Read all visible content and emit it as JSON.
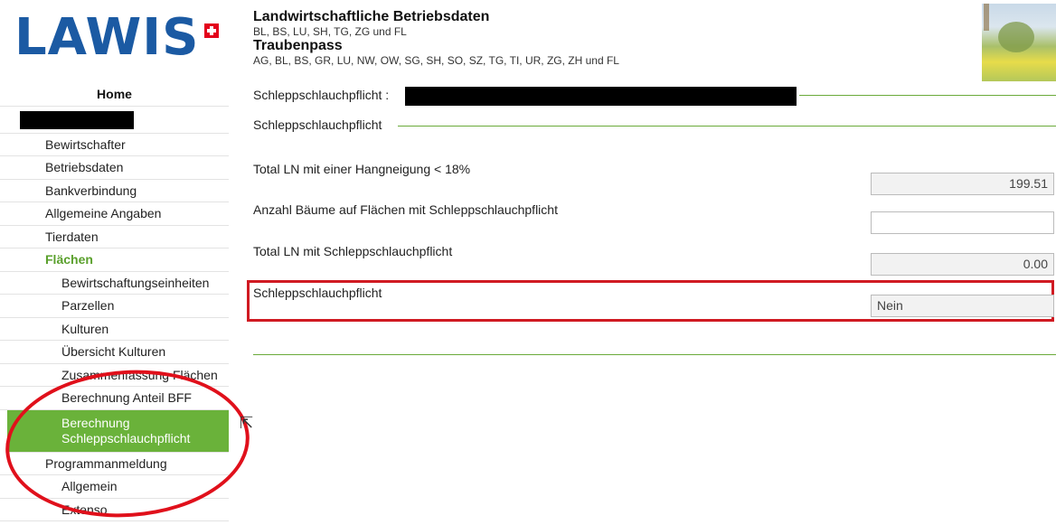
{
  "header": {
    "logo_text": "LAWIS",
    "title1": "Landwirtschaftliche Betriebsdaten",
    "subtitle1": "BL, BS, LU, SH, TG, ZG und FL",
    "title2": "Traubenpass",
    "subtitle2": "AG, BL, BS, GR, LU, NW, OW, SG, SH, SO, SZ, TG, TI, UR, ZG, ZH und FL"
  },
  "sidebar": {
    "home": "Home",
    "items": [
      {
        "label": "Bewirtschafter"
      },
      {
        "label": "Betriebsdaten"
      },
      {
        "label": "Bankverbindung"
      },
      {
        "label": "Allgemeine Angaben"
      },
      {
        "label": "Tierdaten"
      },
      {
        "label": "Flächen"
      }
    ],
    "sub_items": [
      {
        "label": "Bewirtschaftungseinheiten"
      },
      {
        "label": "Parzellen"
      },
      {
        "label": "Kulturen"
      },
      {
        "label": "Übersicht Kulturen"
      },
      {
        "label": "Zusammenfassung Flächen"
      },
      {
        "label": "Berechnung Anteil BFF"
      }
    ],
    "active_line1": "Berechnung",
    "active_line2": "Schleppschlauchpflicht",
    "programm": "Programmanmeldung",
    "prog_items": [
      {
        "label": "Allgemein"
      },
      {
        "label": "Extenso"
      }
    ]
  },
  "main": {
    "section_title": "Schleppschlauchpflicht :",
    "subsection_title": "Schleppschlauchpflicht",
    "fields": [
      {
        "label": "Total LN mit einer Hangneigung < 18%",
        "value": "199.51"
      },
      {
        "label": "Anzahl Bäume auf Flächen mit Schleppschlauchpflicht",
        "value": ""
      },
      {
        "label": "Total LN mit Schleppschlauchpflicht",
        "value": "0.00"
      },
      {
        "label": "Schleppschlauchpflicht",
        "value": "Nein"
      }
    ]
  },
  "colors": {
    "logo": "#1b5aa3",
    "accent_green": "#6ab23a",
    "highlight_red": "#d01a22"
  }
}
